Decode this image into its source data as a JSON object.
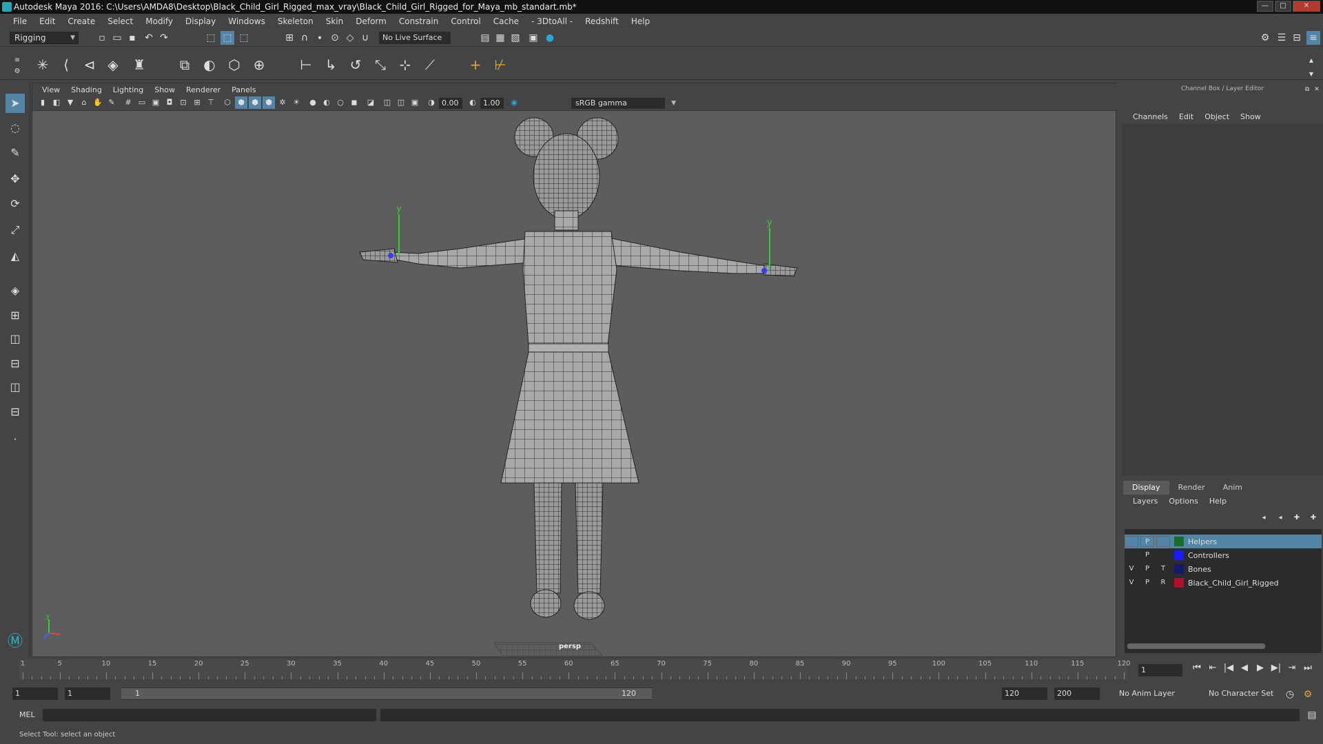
{
  "window": {
    "title": "Autodesk Maya 2016: C:\\Users\\AMDA8\\Desktop\\Black_Child_Girl_Rigged_max_vray\\Black_Child_Girl_Rigged_for_Maya_mb_standart.mb*",
    "btn_min": "—",
    "btn_max": "□",
    "btn_close": "✕"
  },
  "menubar": [
    "File",
    "Edit",
    "Create",
    "Select",
    "Modify",
    "Display",
    "Windows",
    "Skeleton",
    "Skin",
    "Deform",
    "Constrain",
    "Control",
    "Cache",
    "- 3DtoAll -",
    "Redshift",
    "Help"
  ],
  "statusline": {
    "mode": "Rigging",
    "live_surface": "No Live Surface"
  },
  "viewport": {
    "menu": [
      "View",
      "Shading",
      "Lighting",
      "Show",
      "Renderer",
      "Panels"
    ],
    "exposure": "0.00",
    "gamma_value": "1.00",
    "color_space": "sRGB gamma",
    "camera_label": "persp",
    "axis_y": "y",
    "manip_y_left": "y",
    "manip_y_right": "y"
  },
  "channel_box": {
    "title": "Channel Box / Layer Editor",
    "tabs": [
      "Channels",
      "Edit",
      "Object",
      "Show"
    ]
  },
  "layer_editor": {
    "tabs": [
      "Display",
      "Render",
      "Anim"
    ],
    "active_tab": "Display",
    "submenu": [
      "Layers",
      "Options",
      "Help"
    ],
    "layers": [
      {
        "v": "",
        "p": "P",
        "t": "",
        "name": "Helpers",
        "color": "#1b6b2a",
        "selected": true
      },
      {
        "v": "",
        "p": "P",
        "t": "",
        "name": "Controllers",
        "color": "#1a1aff",
        "selected": false
      },
      {
        "v": "V",
        "p": "P",
        "t": "T",
        "name": "Bones",
        "color": "#111a6b",
        "selected": false
      },
      {
        "v": "V",
        "p": "P",
        "t": "R",
        "name": "Black_Child_Girl_Rigged",
        "color": "#b0102a",
        "selected": false
      }
    ]
  },
  "timeline": {
    "ticks": [
      1,
      5,
      10,
      15,
      20,
      25,
      30,
      35,
      40,
      45,
      50,
      55,
      60,
      65,
      70,
      75,
      80,
      85,
      90,
      95,
      100,
      105,
      110,
      115,
      120
    ],
    "min": 1,
    "max": 120,
    "current_frame": "1",
    "playback": [
      "⏮",
      "⇤",
      "|◀",
      "◀",
      "▶",
      "▶|",
      "⇥",
      "⏭"
    ]
  },
  "range": {
    "start": "1",
    "playback_start": "1",
    "slider_start": "1",
    "slider_end": "120",
    "playback_end": "120",
    "end": "200",
    "anim_layer": "No Anim Layer",
    "character_set": "No Character Set"
  },
  "command": {
    "lang": "MEL"
  },
  "help_line": "Select Tool: select an object",
  "colors": {
    "accent_orange": "#e8a23a",
    "selection_blue": "#5285a6",
    "viewport_bg": "#5d5d5d"
  }
}
